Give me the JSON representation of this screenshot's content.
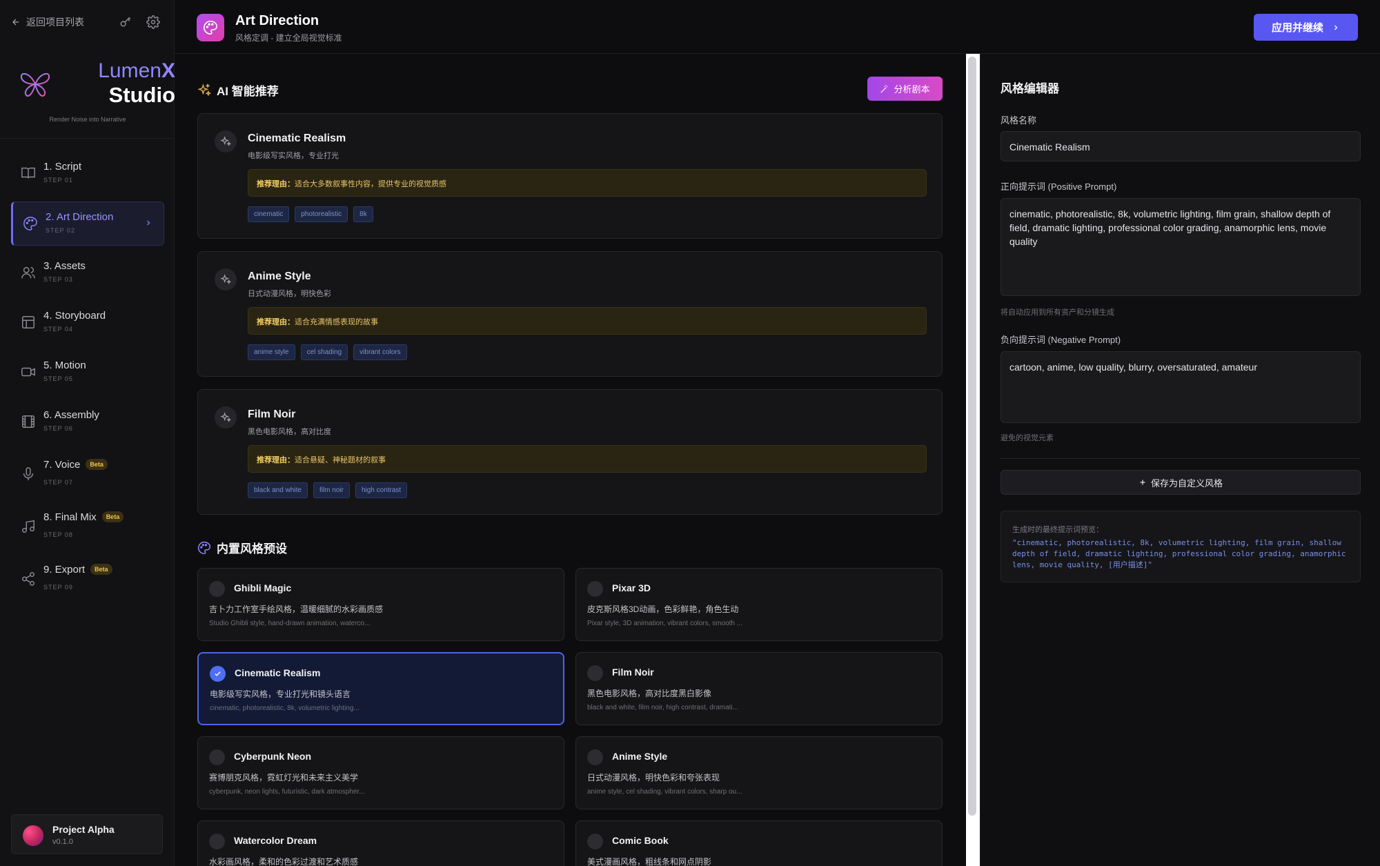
{
  "sidebar": {
    "back_label": "返回项目列表",
    "brand": {
      "lumen": "Lumen",
      "x": "X",
      "studio": "Studio",
      "tagline": "Render Noise into Narrative"
    },
    "items": [
      {
        "label": "1. Script",
        "step": "STEP 01",
        "icon": "book-icon"
      },
      {
        "label": "2. Art Direction",
        "step": "STEP 02",
        "icon": "palette-icon",
        "active": true
      },
      {
        "label": "3. Assets",
        "step": "STEP 03",
        "icon": "users-icon"
      },
      {
        "label": "4. Storyboard",
        "step": "STEP 04",
        "icon": "layout-icon"
      },
      {
        "label": "5. Motion",
        "step": "STEP 05",
        "icon": "video-icon"
      },
      {
        "label": "6. Assembly",
        "step": "STEP 06",
        "icon": "film-icon"
      },
      {
        "label": "7. Voice",
        "step": "STEP 07",
        "icon": "mic-icon",
        "badge": "Beta"
      },
      {
        "label": "8. Final Mix",
        "step": "STEP 08",
        "icon": "music-icon",
        "badge": "Beta"
      },
      {
        "label": "9. Export",
        "step": "STEP 09",
        "icon": "share-icon",
        "badge": "Beta"
      }
    ],
    "project": {
      "name": "Project Alpha",
      "version": "v0.1.0"
    }
  },
  "header": {
    "title": "Art Direction",
    "subtitle": "风格定调 - 建立全局视觉标准",
    "apply_label": "应用并继续"
  },
  "ai_section": {
    "title": "AI 智能推荐",
    "analyze_label": "分析剧本",
    "reason_prefix": "推荐理由：",
    "cards": [
      {
        "title": "Cinematic Realism",
        "desc": "电影级写实风格，专业打光",
        "reason": "适合大多数叙事性内容，提供专业的视觉质感",
        "tags": [
          "cinematic",
          "photorealistic",
          "8k"
        ]
      },
      {
        "title": "Anime Style",
        "desc": "日式动漫风格，明快色彩",
        "reason": "适合充满情感表现的故事",
        "tags": [
          "anime style",
          "cel shading",
          "vibrant colors"
        ]
      },
      {
        "title": "Film Noir",
        "desc": "黑色电影风格，高对比度",
        "reason": "适合悬疑、神秘题材的叙事",
        "tags": [
          "black and white",
          "film noir",
          "high contrast"
        ]
      }
    ]
  },
  "presets_section": {
    "title": "内置风格预设",
    "presets": [
      {
        "name": "Ghibli Magic",
        "desc": "吉卜力工作室手绘风格，温暖细腻的水彩画质感",
        "keys": "Studio Ghibli style, hand-drawn animation, waterco..."
      },
      {
        "name": "Pixar 3D",
        "desc": "皮克斯风格3D动画，色彩鲜艳，角色生动",
        "keys": "Pixar style, 3D animation, vibrant colors, smooth ..."
      },
      {
        "name": "Cinematic Realism",
        "desc": "电影级写实风格，专业打光和镜头语言",
        "keys": "cinematic, photorealistic, 8k, volumetric lighting...",
        "selected": true
      },
      {
        "name": "Film Noir",
        "desc": "黑色电影风格，高对比度黑白影像",
        "keys": "black and white, film noir, high contrast, dramati..."
      },
      {
        "name": "Cyberpunk Neon",
        "desc": "赛博朋克风格，霓虹灯光和未来主义美学",
        "keys": "cyberpunk, neon lights, futuristic, dark atmospher..."
      },
      {
        "name": "Anime Style",
        "desc": "日式动漫风格，明快色彩和夸张表现",
        "keys": "anime style, cel shading, vibrant colors, sharp ou..."
      },
      {
        "name": "Watercolor Dream",
        "desc": "水彩画风格，柔和的色彩过渡和艺术质感",
        "keys": ""
      },
      {
        "name": "Comic Book",
        "desc": "美式漫画风格，粗线条和网点阴影",
        "keys": ""
      }
    ]
  },
  "editor": {
    "title": "风格编辑器",
    "name_label": "风格名称",
    "name_value": "Cinematic Realism",
    "positive_label": "正向提示词 (Positive Prompt)",
    "positive_value": "cinematic, photorealistic, 8k, volumetric lighting, film grain, shallow depth of field, dramatic lighting, professional color grading, anamorphic lens, movie quality",
    "positive_hint": "将自动应用到所有资产和分镜生成",
    "negative_label": "负向提示词 (Negative Prompt)",
    "negative_value": "cartoon, anime, low quality, blurry, oversaturated, amateur",
    "negative_hint": "避免的视觉元素",
    "save_label": "保存为自定义风格",
    "preview_label": "生成时的最终提示词预览：",
    "preview_text": "\"cinematic, photorealistic, 8k, volumetric lighting, film grain, shallow depth of field, dramatic lighting, professional color grading, anamorphic lens, movie quality, [用户描述]\""
  },
  "colors": {
    "accent": "#5957f2",
    "magenta": "#d94ac6",
    "gold": "#f1c44b",
    "select": "#4c66e8"
  }
}
